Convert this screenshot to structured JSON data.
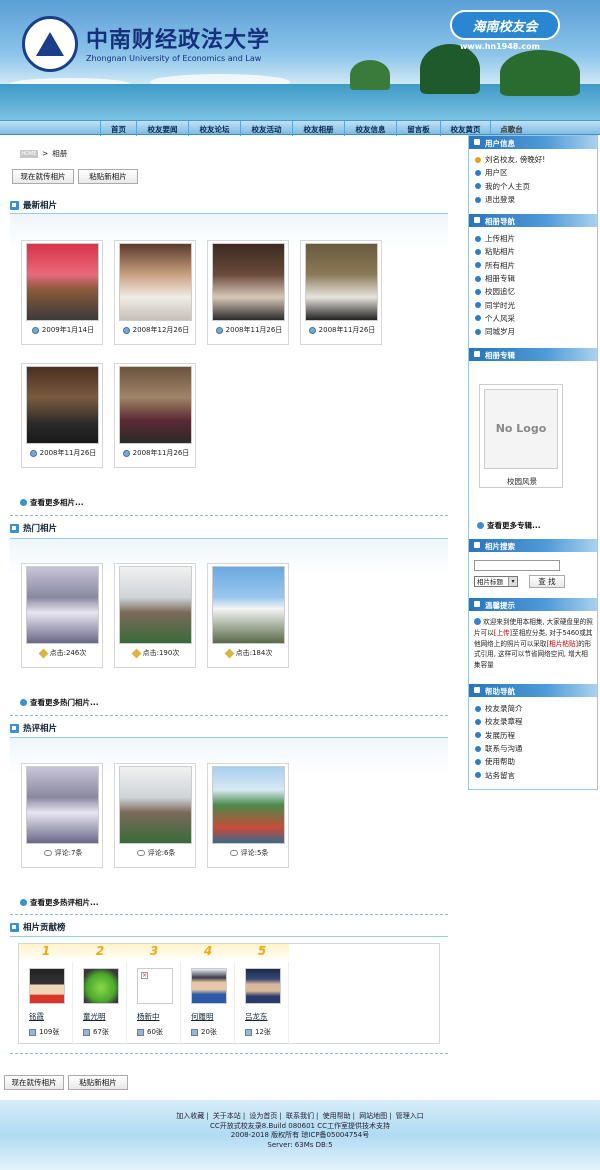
{
  "header": {
    "school_cn": "中南财经政法大学",
    "school_en": "Zhongnan University of Economics and Law",
    "alumni_badge": "海南校友会",
    "url": "www.hn1948.com"
  },
  "nav": {
    "items": [
      "首页",
      "校友要闻",
      "校友论坛",
      "校友活动",
      "校友相册",
      "校友信息",
      "留言板",
      "校友黄页",
      "点歌台"
    ]
  },
  "breadcrumb": {
    "home": "HOME",
    "current": "相册"
  },
  "buttons": {
    "upload": "现在就传相片",
    "paste": "粘贴新相片"
  },
  "latest": {
    "title": "最新相片",
    "photos": [
      {
        "date": "2009年1月14日",
        "img": "latest-1"
      },
      {
        "date": "2008年12月26日",
        "img": "latest-2"
      },
      {
        "date": "2008年11月26日",
        "img": "latest-3"
      },
      {
        "date": "2008年11月26日",
        "img": "latest-4"
      },
      {
        "date": "2008年11月26日",
        "img": "latest-5"
      },
      {
        "date": "2008年11月26日",
        "img": "latest-6"
      }
    ],
    "more": "查看更多相片..."
  },
  "hot": {
    "title": "热门相片",
    "photos": [
      {
        "clicks": "点击:246次"
      },
      {
        "clicks": "点击:190次"
      },
      {
        "clicks": "点击:184次"
      }
    ],
    "more": "查看更多热门相片..."
  },
  "hot_comment": {
    "title": "热评相片",
    "photos": [
      {
        "comments": "评论:7条"
      },
      {
        "comments": "评论:6条"
      },
      {
        "comments": "评论:5条"
      }
    ],
    "more": "查看更多热评相片..."
  },
  "contrib": {
    "title": "相片贡献榜",
    "ranks": [
      {
        "rank": "1",
        "name": "铭霞",
        "count": "109张"
      },
      {
        "rank": "2",
        "name": "童光明",
        "count": "67张"
      },
      {
        "rank": "3",
        "name": "杨新中",
        "count": "60张"
      },
      {
        "rank": "4",
        "name": "何履明",
        "count": "20张"
      },
      {
        "rank": "5",
        "name": "吕龙东",
        "count": "12张"
      }
    ]
  },
  "sidebar": {
    "user_info": {
      "title": "用户信息",
      "items": [
        "刘名校友, 傍晚好!",
        "用户区",
        "我的个人主页",
        "退出登录"
      ]
    },
    "album_nav": {
      "title": "相册导航",
      "items": [
        "上传相片",
        "粘贴相片",
        "所有相片",
        "相册专辑",
        "校园追忆",
        "同学时光",
        "个人风采",
        "同城岁月"
      ]
    },
    "album_collection": {
      "title": "相册专辑",
      "no_logo": "No Logo",
      "album_label": "校园风景",
      "more": "查看更多专辑..."
    },
    "search": {
      "title": "相片搜索",
      "select": "相片标题",
      "button": "查 找",
      "placeholder": ""
    },
    "tips": {
      "title": "温馨提示",
      "text_a": "欢迎来到使用本相集, 大家硬盘里的照片可以",
      "link_upload": "[上传]",
      "text_b": "至相应分类, 对于5460或其他网络上的照片可以采取",
      "link_paste": "[相片粘贴]",
      "text_c": "的形式引用, 这样可以节省网络空间, 增大相集容量"
    },
    "help": {
      "title": "帮助导航",
      "items": [
        "校友录简介",
        "校友录章程",
        "发展历程",
        "联系与沟通",
        "使用帮助",
        "站务留言"
      ]
    }
  },
  "footer": {
    "links": [
      "加入收藏",
      "关于本站",
      "设为首页",
      "联系我们",
      "使用帮助",
      "网站地图",
      "管理入口"
    ],
    "line2": "CC开放式校友录8.Build 080601 CC工作室提供技术支持",
    "line3": "2008-2018 版权所有 琼ICP备05004754号",
    "line4": "Server: 63Ms  DB:5"
  }
}
